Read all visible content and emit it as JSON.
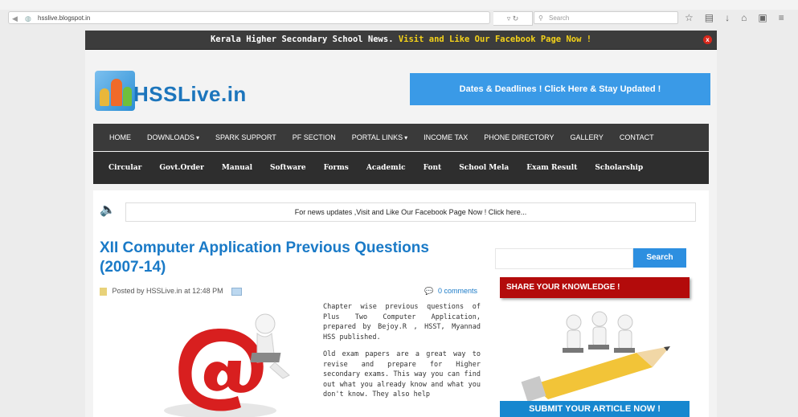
{
  "browser": {
    "url": "hsslive.blogspot.in",
    "search_placeholder": "Search"
  },
  "notice": {
    "text_plain": "Kerala Higher Secondary School News.",
    "text_highlight": "Visit and Like Our Facebook Page Now !",
    "close_label": "x"
  },
  "header": {
    "logo_text": "HSSLive.in",
    "banner_text": "Dates & Deadlines ! Click Here & Stay Updated !"
  },
  "nav_primary": [
    {
      "label": "HOME"
    },
    {
      "label": "DOWNLOADS"
    },
    {
      "label": "SPARK SUPPORT"
    },
    {
      "label": "PF SECTION"
    },
    {
      "label": "PORTAL LINKS"
    },
    {
      "label": "INCOME TAX"
    },
    {
      "label": "PHONE DIRECTORY"
    },
    {
      "label": "GALLERY"
    },
    {
      "label": "CONTACT"
    }
  ],
  "nav_secondary": [
    {
      "label": "Circular"
    },
    {
      "label": "Govt.Order"
    },
    {
      "label": "Manual"
    },
    {
      "label": "Software"
    },
    {
      "label": "Forms"
    },
    {
      "label": "Academic"
    },
    {
      "label": "Font"
    },
    {
      "label": "School Mela"
    },
    {
      "label": "Exam Result"
    },
    {
      "label": "Scholarship"
    }
  ],
  "marquee": {
    "text": "For news updates ,Visit and Like Our Facebook Page Now ! Click here..."
  },
  "post": {
    "title": "XII Computer Application Previous Questions (2007-14)",
    "meta": "Posted by HSSLive.in at 12:48 PM",
    "comments": "0 comments",
    "para1": "Chapter wise previous questions of Plus Two Computer Application, prepared by Bejoy.R , HSST, Myannad HSS published.",
    "para2": "Old exam papers are a great way to revise and prepare for Higher secondary exams. This way you can find out what you already know and what you don't know. They also help"
  },
  "sidebar": {
    "search_button": "Search",
    "share_header": "SHARE YOUR KNOWLEDGE !",
    "submit_label": "SUBMIT YOUR ARTICLE NOW !"
  },
  "colors": {
    "accent_blue": "#1a7ac7",
    "banner_blue": "#3a9ae7",
    "nav_dark": "#3a3a3a",
    "share_red": "#b30b0b",
    "notice_yellow": "#f4d21a"
  }
}
